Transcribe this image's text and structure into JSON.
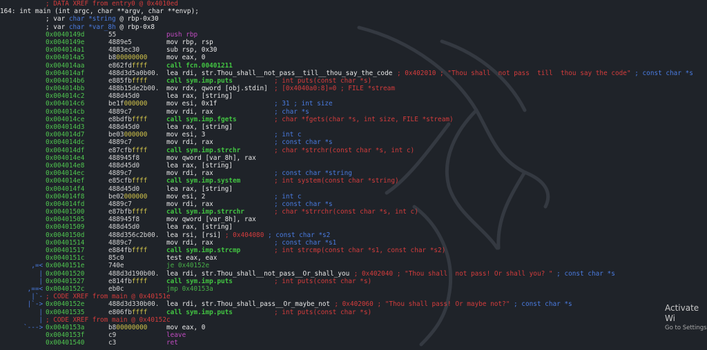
{
  "header": {
    "xref_top": "; DATA XREF from entry0 @ 0x4010ed",
    "func_number": "164:",
    "func_sig": "int main (int argc, char **argv, char **envp);",
    "vars": [
      {
        "prefix": "; var ",
        "type": "char *string",
        "rest": " @ rbp-0x30"
      },
      {
        "prefix": "; var ",
        "type": "char *var_8h",
        "rest": " @ rbp-0x8"
      }
    ]
  },
  "lines": [
    {
      "a": "0x0040149d",
      "b1": "55",
      "b2": "",
      "mnem": "push rbp",
      "mk": "push",
      "c": ""
    },
    {
      "a": "0x0040149e",
      "b1": "4889e5",
      "b2": "",
      "mnem": "mov rbp, rsp",
      "c": ""
    },
    {
      "a": "0x004014a1",
      "b1": "4883ec30",
      "b2": "",
      "mnem": "sub rsp, 0x30",
      "c": ""
    },
    {
      "a": "0x004014a5",
      "b1": "b8",
      "b2": "00000000",
      "mnem": "mov eax, 0",
      "c": ""
    },
    {
      "a": "0x004014aa",
      "b1": "e862fd",
      "b2": "ffff",
      "mnem": "call fcn.00401211",
      "mk": "call",
      "c": ""
    },
    {
      "a": "0x004014af",
      "b1": "488d3d5a0b00.",
      "b2": "",
      "mnem": "lea rdi, str.Thou_shall__not_pass__till__thou_say_the_code",
      "c": "; 0x402010 ; \"Thou shall  not pass  till  thou say the code\"",
      "cb": " ; const char *s",
      "cl": 443
    },
    {
      "a": "0x004014b6",
      "b1": "e885fb",
      "b2": "ffff",
      "mnem": "call sym.imp.puts",
      "mk": "call",
      "c": "; int puts(const char *s)"
    },
    {
      "a": "0x004014bb",
      "b1": "488b15de2b00.",
      "b2": "",
      "mnem": "mov rdx, qword [obj.stdin]",
      "c": "; [0x4040a0:8]=0 ; FILE *stream"
    },
    {
      "a": "0x004014c2",
      "b1": "488d45d0",
      "b2": "",
      "mnem": "lea rax, [string]",
      "c": ""
    },
    {
      "a": "0x004014c6",
      "b1": "be1f",
      "b2": "000000",
      "mnem": "mov esi, 0x1f",
      "c": "; 31 ; int size",
      "cc": "blue"
    },
    {
      "a": "0x004014cb",
      "b1": "4889c7",
      "b2": "",
      "mnem": "mov rdi, rax",
      "c": "; char *s",
      "cc": "blue"
    },
    {
      "a": "0x004014ce",
      "b1": "e8bdfb",
      "b2": "ffff",
      "mnem": "call sym.imp.fgets",
      "mk": "call",
      "c": "; char *fgets(char *s, int size, FILE *stream)"
    },
    {
      "a": "0x004014d3",
      "b1": "488d45d0",
      "b2": "",
      "mnem": "lea rax, [string]",
      "c": ""
    },
    {
      "a": "0x004014d7",
      "b1": "be03",
      "b2": "000000",
      "mnem": "mov esi, 3",
      "c": "; int c",
      "cc": "blue"
    },
    {
      "a": "0x004014dc",
      "b1": "4889c7",
      "b2": "",
      "mnem": "mov rdi, rax",
      "c": "; const char *s",
      "cc": "blue"
    },
    {
      "a": "0x004014df",
      "b1": "e87cfb",
      "b2": "ffff",
      "mnem": "call sym.imp.strchr",
      "mk": "call",
      "c": "; char *strchr(const char *s, int c)"
    },
    {
      "a": "0x004014e4",
      "b1": "488945f8",
      "b2": "",
      "mnem": "mov qword [var_8h], rax",
      "c": ""
    },
    {
      "a": "0x004014e8",
      "b1": "488d45d0",
      "b2": "",
      "mnem": "lea rax, [string]",
      "c": ""
    },
    {
      "a": "0x004014ec",
      "b1": "4889c7",
      "b2": "",
      "mnem": "mov rdi, rax",
      "c": "; const char *string",
      "cc": "blue"
    },
    {
      "a": "0x004014ef",
      "b1": "e85cfb",
      "b2": "ffff",
      "mnem": "call sym.imp.system",
      "mk": "call",
      "c": "; int system(const char *string)"
    },
    {
      "a": "0x004014f4",
      "b1": "488d45d0",
      "b2": "",
      "mnem": "lea rax, [string]",
      "c": ""
    },
    {
      "a": "0x004014f8",
      "b1": "be02",
      "b2": "000000",
      "mnem": "mov esi, 2",
      "c": "; int c",
      "cc": "blue"
    },
    {
      "a": "0x004014fd",
      "b1": "4889c7",
      "b2": "",
      "mnem": "mov rdi, rax",
      "c": "; const char *s",
      "cc": "blue"
    },
    {
      "a": "0x00401500",
      "b1": "e87bfb",
      "b2": "ffff",
      "mnem": "call sym.imp.strrchr",
      "mk": "call",
      "c": "; char *strrchr(const char *s, int c)"
    },
    {
      "a": "0x00401505",
      "b1": "488945f8",
      "b2": "",
      "mnem": "mov qword [var_8h], rax",
      "c": ""
    },
    {
      "a": "0x00401509",
      "b1": "488d45d0",
      "b2": "",
      "mnem": "lea rax, [string]",
      "c": ""
    },
    {
      "a": "0x0040150d",
      "b1": "488d356c2b00.",
      "b2": "",
      "mnem": "lea rsi, [rsi]",
      "c": "; 0x404080",
      "cb": " ; const char *s2",
      "cl": 65
    },
    {
      "a": "0x00401514",
      "b1": "4889c7",
      "b2": "",
      "mnem": "mov rdi, rax",
      "c": "; const char *s1",
      "cc": "blue"
    },
    {
      "a": "0x00401517",
      "b1": "e884fb",
      "b2": "ffff",
      "mnem": "call sym.imp.strcmp",
      "mk": "call",
      "c": "; int strcmp(const char *s1, const char *s2)"
    },
    {
      "a": "0x0040151c",
      "b1": "85c0",
      "b2": "",
      "mnem": "test eax, eax",
      "c": ""
    },
    {
      "a": "0x0040151e",
      "b1": "740e",
      "b2": "",
      "mnem": "je 0x40152e",
      "mk": "jmp",
      "c": "",
      "arrow": ",=<"
    },
    {
      "a": "0x00401520",
      "b1": "488d3d190b00.",
      "b2": "",
      "mnem": "lea rdi, str.Thou_shall__not_pass__Or_shall_you",
      "c": "; 0x402040 ; \"Thou shall  not pass! Or shall you? \"",
      "cb": " ; const char *s",
      "cl": 409,
      "arrow": "|"
    },
    {
      "a": "0x00401527",
      "b1": "e814fb",
      "b2": "ffff",
      "mnem": "call sym.imp.puts",
      "mk": "call",
      "c": "; int puts(const char *s)",
      "arrow": "|"
    },
    {
      "a": "0x0040152c",
      "b1": "eb0c",
      "b2": "",
      "mnem": "jmp 0x40153a",
      "mk": "jmp",
      "c": "",
      "arrow": ",==<"
    },
    {
      "xref": "; CODE XREF from main @ 0x40151e",
      "arrow": "|`-"
    },
    {
      "a": "0x0040152e",
      "b1": "488d3d330b00.",
      "b2": "",
      "mnem": "lea rdi, str.Thou_shall_pass__Or_maybe_not",
      "c": "; 0x402060 ; \"Thou shall pass! Or maybe not?\"",
      "cb": " ; const char *s",
      "cl": 346,
      "arrow": "|`->"
    },
    {
      "a": "0x00401535",
      "b1": "e806fb",
      "b2": "ffff",
      "mnem": "call sym.imp.puts",
      "mk": "call",
      "c": "; int puts(const char *s)",
      "arrow": "|"
    },
    {
      "xref": "; CODE XREF from main @ 0x40152c",
      "arrow": "|"
    },
    {
      "a": "0x0040153a",
      "b1": "b8",
      "b2": "00000000",
      "mnem": "mov eax, 0",
      "c": "",
      "arrow": "`--->"
    },
    {
      "a": "0x0040153f",
      "b1": "c9",
      "b2": "",
      "mnem": "leave",
      "mk": "leave",
      "c": ""
    },
    {
      "a": "0x00401540",
      "b1": "c3",
      "b2": "",
      "mnem": "ret",
      "mk": "leave",
      "c": ""
    }
  ],
  "watermark": {
    "title": "Activate Wi",
    "subtitle": "Go to Settings"
  },
  "colors": {
    "background": "#1f2329",
    "address": "#4fc54f",
    "comment": "#d43c3c",
    "type": "#4a7be0",
    "call": "#42c442"
  }
}
